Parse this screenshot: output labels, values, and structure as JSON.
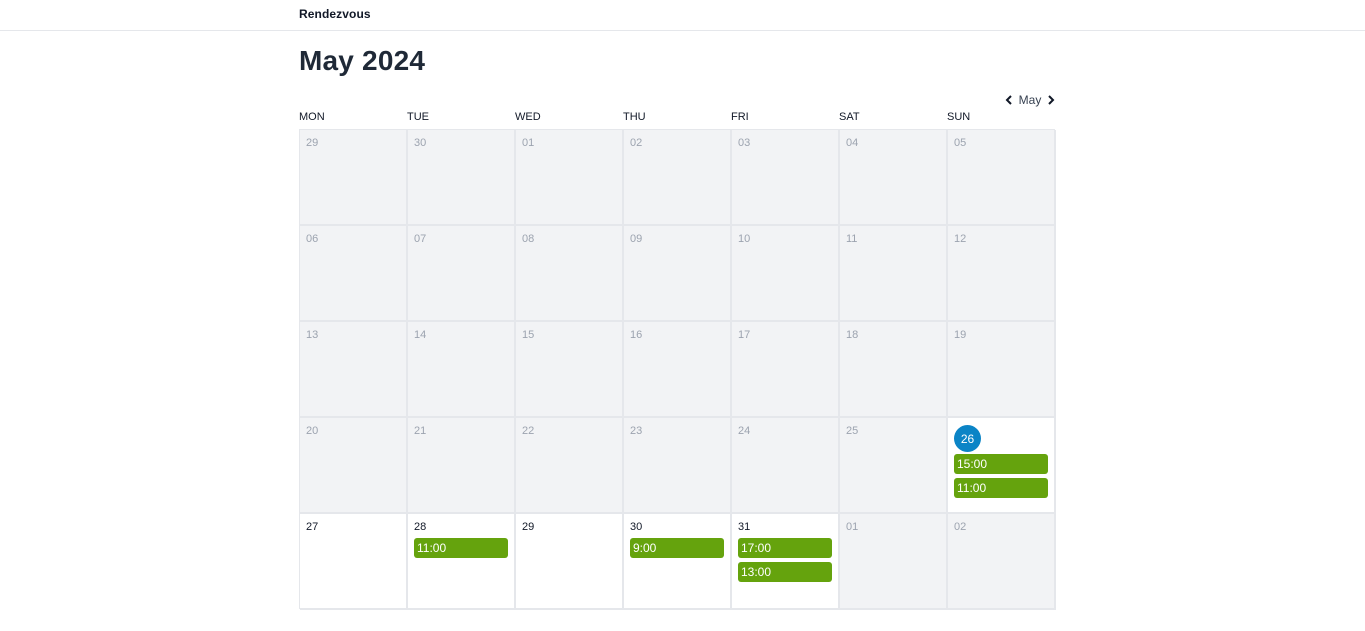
{
  "header": {
    "brand": "Rendezvous"
  },
  "calendar": {
    "title": "May 2024",
    "nav": {
      "month_label": "May"
    },
    "weekdays": [
      "MON",
      "TUE",
      "WED",
      "THU",
      "FRI",
      "SAT",
      "SUN"
    ],
    "colors": {
      "today": "#0b84c6",
      "slot": "#65a30d",
      "inactive_bg": "#f2f3f5"
    },
    "weeks": [
      [
        {
          "day": "29",
          "active": false,
          "slots": []
        },
        {
          "day": "30",
          "active": false,
          "slots": []
        },
        {
          "day": "01",
          "active": false,
          "slots": []
        },
        {
          "day": "02",
          "active": false,
          "slots": []
        },
        {
          "day": "03",
          "active": false,
          "slots": []
        },
        {
          "day": "04",
          "active": false,
          "slots": []
        },
        {
          "day": "05",
          "active": false,
          "slots": []
        }
      ],
      [
        {
          "day": "06",
          "active": false,
          "slots": []
        },
        {
          "day": "07",
          "active": false,
          "slots": []
        },
        {
          "day": "08",
          "active": false,
          "slots": []
        },
        {
          "day": "09",
          "active": false,
          "slots": []
        },
        {
          "day": "10",
          "active": false,
          "slots": []
        },
        {
          "day": "11",
          "active": false,
          "slots": []
        },
        {
          "day": "12",
          "active": false,
          "slots": []
        }
      ],
      [
        {
          "day": "13",
          "active": false,
          "slots": []
        },
        {
          "day": "14",
          "active": false,
          "slots": []
        },
        {
          "day": "15",
          "active": false,
          "slots": []
        },
        {
          "day": "16",
          "active": false,
          "slots": []
        },
        {
          "day": "17",
          "active": false,
          "slots": []
        },
        {
          "day": "18",
          "active": false,
          "slots": []
        },
        {
          "day": "19",
          "active": false,
          "slots": []
        }
      ],
      [
        {
          "day": "20",
          "active": false,
          "slots": []
        },
        {
          "day": "21",
          "active": false,
          "slots": []
        },
        {
          "day": "22",
          "active": false,
          "slots": []
        },
        {
          "day": "23",
          "active": false,
          "slots": []
        },
        {
          "day": "24",
          "active": false,
          "slots": []
        },
        {
          "day": "25",
          "active": false,
          "slots": []
        },
        {
          "day": "26",
          "active": true,
          "today": true,
          "slots": [
            "15:00",
            "11:00"
          ]
        }
      ],
      [
        {
          "day": "27",
          "active": true,
          "slots": []
        },
        {
          "day": "28",
          "active": true,
          "slots": [
            "11:00"
          ]
        },
        {
          "day": "29",
          "active": true,
          "slots": []
        },
        {
          "day": "30",
          "active": true,
          "slots": [
            "9:00"
          ]
        },
        {
          "day": "31",
          "active": true,
          "slots": [
            "17:00",
            "13:00"
          ]
        },
        {
          "day": "01",
          "active": false,
          "slots": []
        },
        {
          "day": "02",
          "active": false,
          "slots": []
        }
      ]
    ]
  }
}
